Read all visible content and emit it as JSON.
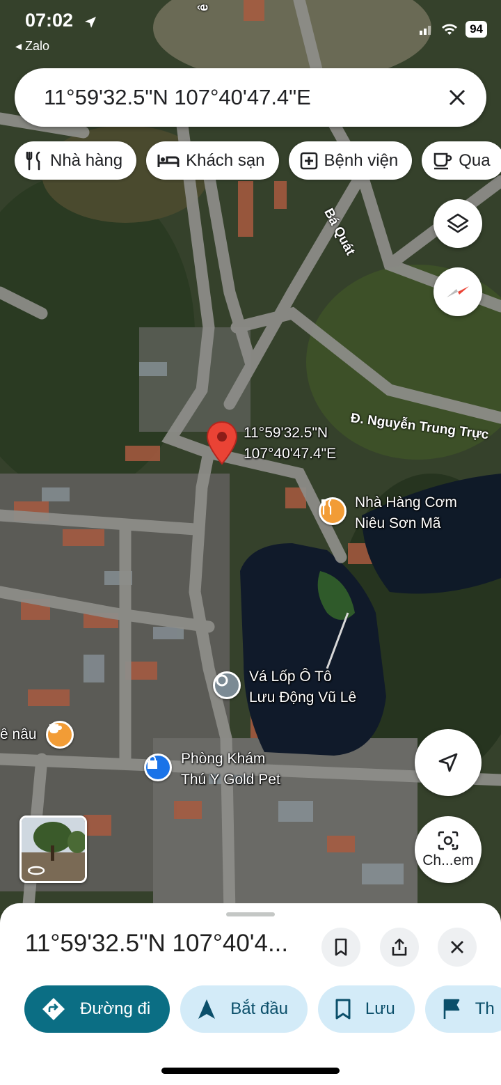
{
  "status_bar": {
    "time": "07:02",
    "back_app": "Zalo",
    "battery": "94"
  },
  "search": {
    "value": "11°59'32.5\"N 107°40'47.4\"E"
  },
  "chips": [
    {
      "label": "Nhà hàng",
      "icon": "fork-knife-icon"
    },
    {
      "label": "Khách sạn",
      "icon": "bed-icon"
    },
    {
      "label": "Bệnh viện",
      "icon": "hospital-icon"
    },
    {
      "label": "Qua",
      "icon": "cup-icon"
    }
  ],
  "map": {
    "pin": {
      "line1": "11°59'32.5\"N",
      "line2": "107°40'47.4\"E",
      "color": "#ea4335"
    },
    "roads": [
      "Đ. Nguyễn Trung Trực",
      "Bá Quát",
      "ê"
    ],
    "pois": [
      {
        "line1": "Nhà Hàng Cơm",
        "line2": "Niêu Sơn Mã",
        "icon": "restaurant-icon",
        "color": "#f29c36"
      },
      {
        "line1": "Vá Lốp Ô Tô",
        "line2": "Lưu Động Vũ Lê",
        "icon": "place-icon",
        "color": "#7b8a94"
      },
      {
        "line1": "ê nâu",
        "icon": "cafe-icon",
        "color": "#f29c36"
      },
      {
        "line1": "Phòng Khám",
        "line2": "Thú Y Gold Pet",
        "icon": "shopping-icon",
        "color": "#1a73e8"
      }
    ],
    "screenshot_label": "Ch...em"
  },
  "sheet": {
    "title": "11°59'32.5\"N 107°40'4...",
    "actions": [
      {
        "label": "Đường đi",
        "icon": "directions-icon"
      },
      {
        "label": "Bắt đầu",
        "icon": "navigation-icon"
      },
      {
        "label": "Lưu",
        "icon": "bookmark-icon"
      },
      {
        "label": "Th",
        "icon": "flag-icon"
      }
    ]
  },
  "colors": {
    "accent": "#0b6e84",
    "chip_bg": "#d3ebf8",
    "pin": "#ea4335"
  }
}
